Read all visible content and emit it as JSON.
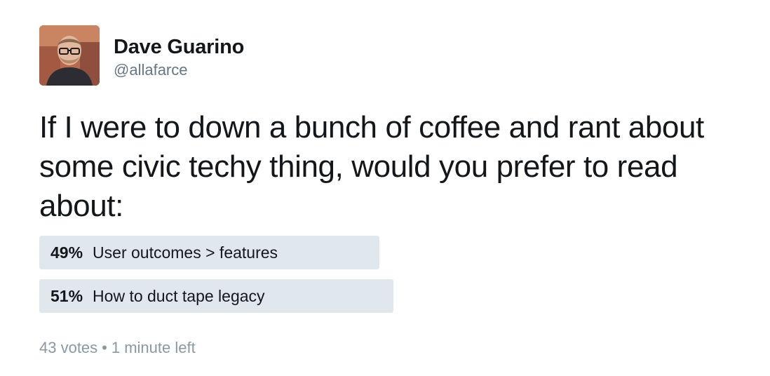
{
  "user": {
    "display_name": "Dave Guarino",
    "handle": "@allafarce",
    "avatar_icon": "profile-photo"
  },
  "tweet": {
    "text": "If I were to down a bunch of coffee and rant about some civic techy thing, would you prefer to read about:"
  },
  "poll": {
    "bar_color": "#e1e8ed",
    "options": [
      {
        "percent": "49%",
        "value": 0.49,
        "label": "User outcomes > features"
      },
      {
        "percent": "51%",
        "value": 0.51,
        "label": "How to duct tape legacy"
      }
    ],
    "votes": "43 votes",
    "separator": "•",
    "time_left": "1 minute left"
  }
}
